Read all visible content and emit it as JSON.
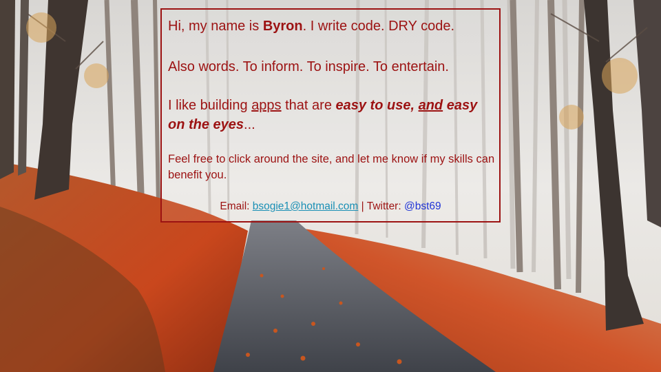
{
  "background": {
    "description_icon": "autumn-forest-road-photo",
    "colors": {
      "fog": "#e5e3df",
      "leaves": "#c8511e",
      "road": "#4a4d54",
      "trunk": "#3c3430"
    }
  },
  "card": {
    "border_color": "#9c1212",
    "text_color": "#9c1212",
    "line1": {
      "pre": "Hi, my name is ",
      "name": "Byron",
      "post": ". I write code. DRY code."
    },
    "line2": "Also words. To inform. To inspire. To entertain.",
    "line3": {
      "pre": "I like building ",
      "link": "apps",
      "mid": " that are ",
      "em1": "easy to use,",
      "space": " ",
      "em_link": "and",
      "br_space": " ",
      "em2": "easy on the eyes",
      "tail": "..."
    },
    "line4": "Feel free to click around the site, and let me know if my skills can benefit you.",
    "contact": {
      "email_label": "Email: ",
      "email": "bsogie1@hotmail.com",
      "sep": " | Twitter: ",
      "twitter": "@bst69",
      "email_color": "#1a8fb5",
      "twitter_color": "#1f33d6"
    }
  }
}
